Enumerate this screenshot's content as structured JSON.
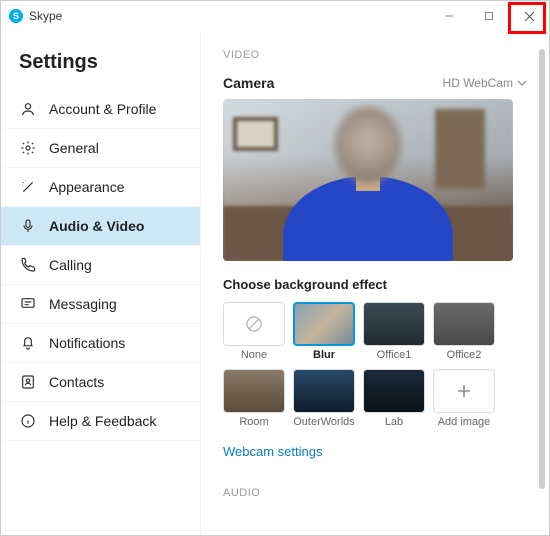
{
  "window": {
    "title": "Skype"
  },
  "sidebar": {
    "heading": "Settings",
    "items": [
      {
        "label": "Account & Profile"
      },
      {
        "label": "General"
      },
      {
        "label": "Appearance"
      },
      {
        "label": "Audio & Video"
      },
      {
        "label": "Calling"
      },
      {
        "label": "Messaging"
      },
      {
        "label": "Notifications"
      },
      {
        "label": "Contacts"
      },
      {
        "label": "Help & Feedback"
      }
    ]
  },
  "video": {
    "section": "VIDEO",
    "camera_label": "Camera",
    "camera_selected": "HD WebCam",
    "bg_heading": "Choose background effect",
    "effects": [
      {
        "label": "None"
      },
      {
        "label": "Blur"
      },
      {
        "label": "Office1"
      },
      {
        "label": "Office2"
      },
      {
        "label": "Room"
      },
      {
        "label": "OuterWorlds"
      },
      {
        "label": "Lab"
      },
      {
        "label": "Add image"
      }
    ],
    "webcam_link": "Webcam settings"
  },
  "audio": {
    "section": "AUDIO"
  }
}
